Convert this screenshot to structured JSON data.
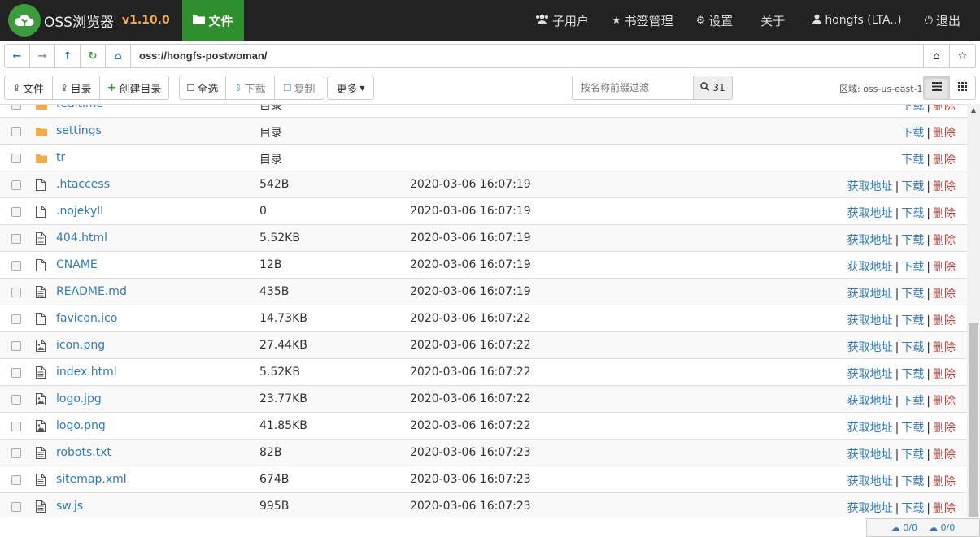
{
  "app": {
    "title": "OSS浏览器",
    "version": "v1.10.0",
    "files_tab": "文件"
  },
  "nav": {
    "subusers": "子用户",
    "bookmarks": "书签管理",
    "settings": "设置",
    "about": "关于",
    "user": "hongfs (LTA..)",
    "logout": "退出"
  },
  "address": {
    "path": "oss://hongfs-postwoman/"
  },
  "toolbar": {
    "upload_file": "文件",
    "upload_dir": "目录",
    "create_dir": "创建目录",
    "select_all": "全选",
    "download": "下载",
    "copy": "复制",
    "more": "更多",
    "filter_placeholder": "按名称前缀过滤",
    "count": "31",
    "region": "区域: oss-us-east-1"
  },
  "ops": {
    "get_url": "获取地址",
    "download": "下载",
    "delete": "删除"
  },
  "rows": [
    {
      "name": "realtime",
      "size": "目录",
      "date": "",
      "type": "folder"
    },
    {
      "name": "settings",
      "size": "目录",
      "date": "",
      "type": "folder"
    },
    {
      "name": "tr",
      "size": "目录",
      "date": "",
      "type": "folder"
    },
    {
      "name": ".htaccess",
      "size": "542B",
      "date": "2020-03-06 16:07:19",
      "type": "file"
    },
    {
      "name": ".nojekyll",
      "size": "0",
      "date": "2020-03-06 16:07:19",
      "type": "file"
    },
    {
      "name": "404.html",
      "size": "5.52KB",
      "date": "2020-03-06 16:07:19",
      "type": "text"
    },
    {
      "name": "CNAME",
      "size": "12B",
      "date": "2020-03-06 16:07:19",
      "type": "file"
    },
    {
      "name": "README.md",
      "size": "435B",
      "date": "2020-03-06 16:07:19",
      "type": "text"
    },
    {
      "name": "favicon.ico",
      "size": "14.73KB",
      "date": "2020-03-06 16:07:22",
      "type": "file"
    },
    {
      "name": "icon.png",
      "size": "27.44KB",
      "date": "2020-03-06 16:07:22",
      "type": "image"
    },
    {
      "name": "index.html",
      "size": "5.52KB",
      "date": "2020-03-06 16:07:22",
      "type": "text"
    },
    {
      "name": "logo.jpg",
      "size": "23.77KB",
      "date": "2020-03-06 16:07:22",
      "type": "image"
    },
    {
      "name": "logo.png",
      "size": "41.85KB",
      "date": "2020-03-06 16:07:22",
      "type": "image"
    },
    {
      "name": "robots.txt",
      "size": "82B",
      "date": "2020-03-06 16:07:23",
      "type": "text"
    },
    {
      "name": "sitemap.xml",
      "size": "674B",
      "date": "2020-03-06 16:07:23",
      "type": "text"
    },
    {
      "name": "sw.js",
      "size": "995B",
      "date": "2020-03-06 16:07:23",
      "type": "text"
    }
  ],
  "status": {
    "uploads": "0/0",
    "downloads": "0/0"
  },
  "colors": {
    "navbar": "#222222",
    "active_tab": "#2f8f2f",
    "link": "#337ab7",
    "delete": "#a94442",
    "version": "#f0ad4e"
  }
}
